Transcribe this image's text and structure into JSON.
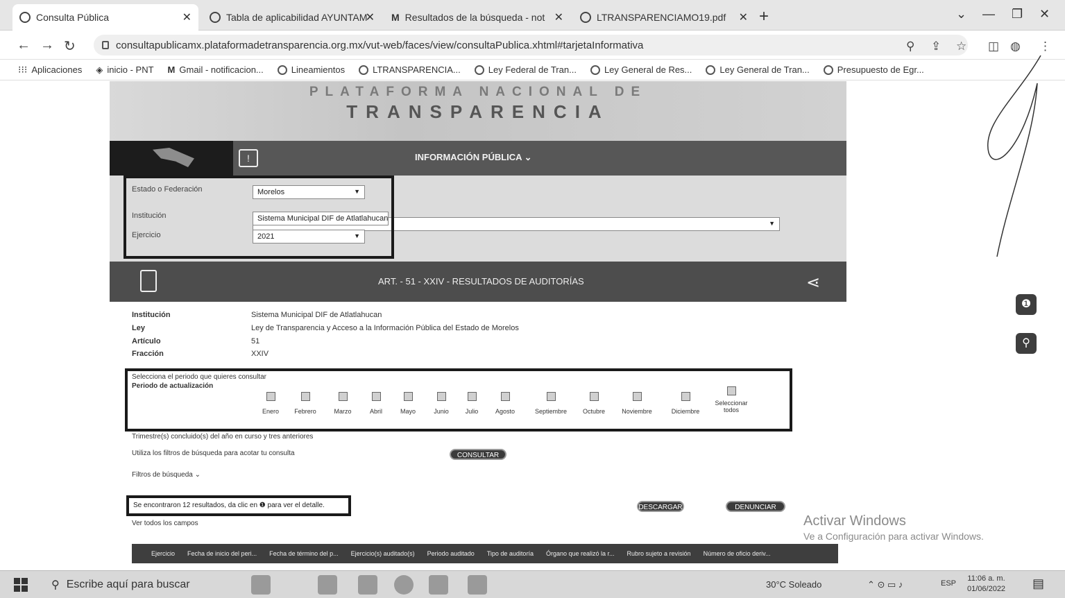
{
  "browser": {
    "tabs": [
      {
        "label": "Consulta Pública",
        "active": true
      },
      {
        "label": "Tabla de aplicabilidad AYUNTAM"
      },
      {
        "label": "Resultados de la búsqueda - not"
      },
      {
        "label": "LTRANSPARENCIAMO19.pdf"
      }
    ],
    "url": "consultapublicamx.plataformadetransparencia.org.mx/vut-web/faces/view/consultaPublica.xhtml#tarjetaInformativa",
    "bookmarks": [
      "Aplicaciones",
      "inicio - PNT",
      "Gmail - notificacion...",
      "Lineamientos",
      "LTRANSPARENCIA...",
      "Ley Federal de Tran...",
      "Ley General de Res...",
      "Ley General de Tran...",
      "Presupuesto de Egr..."
    ]
  },
  "banner": {
    "line1": "PLATAFORMA NACIONAL DE",
    "line2": "TRANSPARENCIA"
  },
  "nav": {
    "menu_label": "INFORMACIÓN PÚBLICA ⌄"
  },
  "filters": {
    "estado_label": "Estado o Federación",
    "estado_value": "Morelos",
    "institucion_label": "Institución",
    "institucion_value": "Sistema Municipal DIF de Atlatlahucan",
    "ejercicio_label": "Ejercicio",
    "ejercicio_value": "2021"
  },
  "section": {
    "title": "ART. - 51 - XXIV - RESULTADOS DE AUDITORÍAS"
  },
  "info": {
    "rows": [
      {
        "label": "Institución",
        "value": "Sistema Municipal DIF de Atlatlahucan"
      },
      {
        "label": "Ley",
        "value": "Ley de Transparencia y Acceso a la Información Pública del Estado de Morelos"
      },
      {
        "label": "Artículo",
        "value": "51"
      },
      {
        "label": "Fracción",
        "value": "XXIV"
      }
    ]
  },
  "period": {
    "prompt": "Selecciona el periodo que quieres consultar",
    "label": "Periodo de actualización",
    "months": [
      "Enero",
      "Febrero",
      "Marzo",
      "Abril",
      "Mayo",
      "Junio",
      "Julio",
      "Agosto",
      "Septiembre",
      "Octubre",
      "Noviembre",
      "Diciembre"
    ],
    "select_all": "Seleccionar todos",
    "note": "Trimestre(s) concluido(s) del año en curso y tres anteriores"
  },
  "query": {
    "hint": "Utiliza los filtros de búsqueda para acotar tu consulta",
    "consultar": "CONSULTAR",
    "filtros": "Filtros de búsqueda ⌄"
  },
  "results": {
    "text": "Se encontraron 12 resultados, da clic en ❶ para ver el detalle.",
    "descargar": "DESCARGAR",
    "denunciar": "DENUNCIAR",
    "ver_todos": "Ver todos los campos"
  },
  "table": {
    "columns": [
      "Ejercicio",
      "Fecha de inicio del peri...",
      "Fecha de término del p...",
      "Ejercicio(s) auditado(s)",
      "Periodo auditado",
      "Tipo de auditoría",
      "Órgano que realizó la r...",
      "Rubro sujeto a revisión",
      "Número de oficio deriv..."
    ]
  },
  "windows": {
    "activate_title": "Activar Windows",
    "activate_sub": "Ve a Configuración para activar Windows."
  },
  "taskbar": {
    "search_placeholder": "Escribe aquí para buscar",
    "weather": "30°C Soleado",
    "lang": "ESP",
    "time": "11:06 a. m.",
    "date": "01/06/2022"
  },
  "icons": {
    "globe": "globe-icon",
    "lock": "lock-icon",
    "share": "share-icon",
    "clipboard": "clipboard-icon",
    "info": "info-icon",
    "search_zoom": "zoom-icon"
  }
}
